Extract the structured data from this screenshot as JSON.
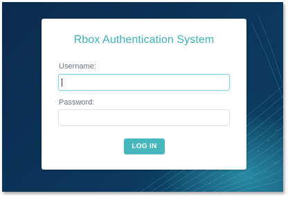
{
  "login": {
    "title": "Rbox Authentication System",
    "username_label": "Username:",
    "username_value": "",
    "password_label": "Password:",
    "password_value": "",
    "submit_label": "LOG IN"
  },
  "colors": {
    "accent": "#46b7bd",
    "title": "#3fb1b8",
    "background": "#0b3257"
  }
}
